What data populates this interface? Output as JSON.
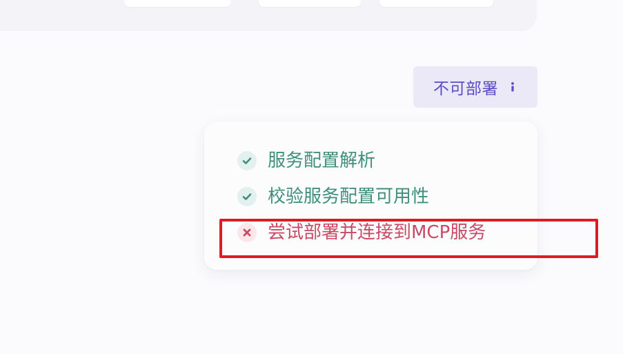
{
  "status_button": {
    "label": "不可部署",
    "icon": "info-icon",
    "color": "#5b4bc4",
    "background": "#ebe9f8"
  },
  "steps": [
    {
      "label": "服务配置解析",
      "status": "success",
      "icon": "check-icon",
      "color": "#3f8f7c"
    },
    {
      "label": "校验服务配置可用性",
      "status": "success",
      "icon": "check-icon",
      "color": "#3f8f7c"
    },
    {
      "label": "尝试部署并连接到MCP服务",
      "status": "failed",
      "icon": "close-icon",
      "color": "#c84a66"
    }
  ],
  "annotation": {
    "color": "#e01a22"
  }
}
